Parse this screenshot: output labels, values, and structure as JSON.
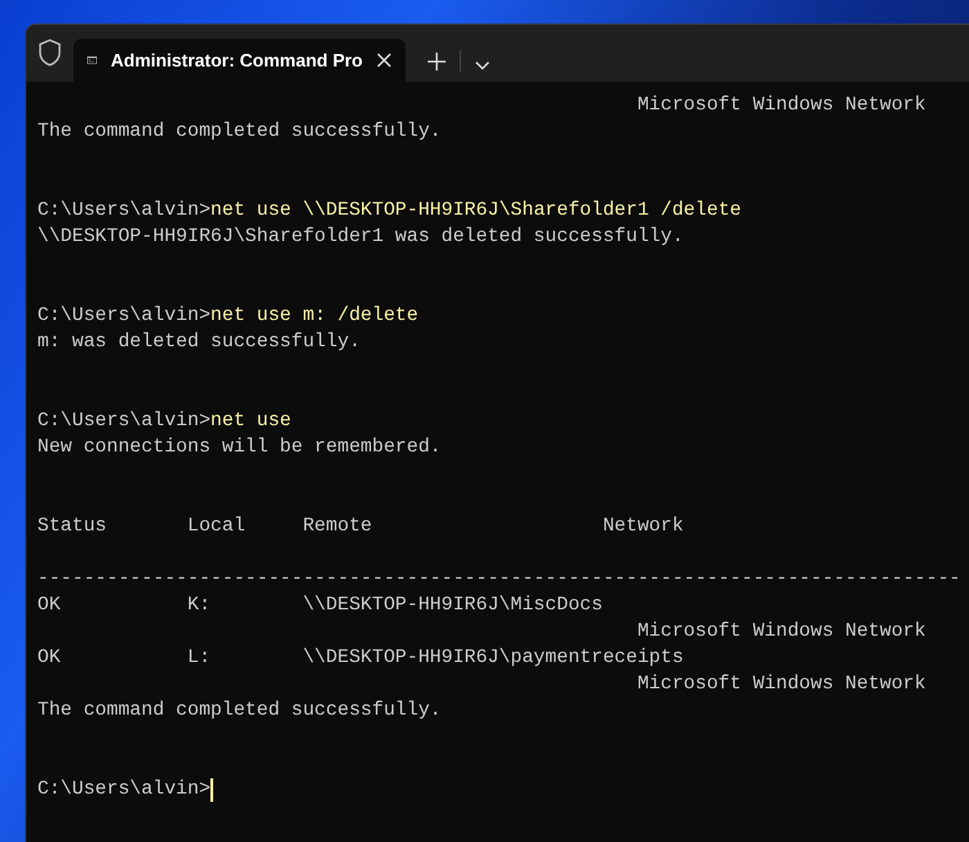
{
  "window": {
    "tab_title": "Administrator: Command Pro"
  },
  "terminal": {
    "lines": [
      {
        "kind": "output",
        "text": "                                                    Microsoft Windows Network"
      },
      {
        "kind": "output",
        "text": "The command completed successfully."
      },
      {
        "kind": "blank"
      },
      {
        "kind": "blank"
      },
      {
        "kind": "command",
        "prompt": "C:\\Users\\alvin>",
        "command": "net use \\\\DESKTOP-HH9IR6J\\Sharefolder1 /delete"
      },
      {
        "kind": "output",
        "text": "\\\\DESKTOP-HH9IR6J\\Sharefolder1 was deleted successfully."
      },
      {
        "kind": "blank"
      },
      {
        "kind": "blank"
      },
      {
        "kind": "command",
        "prompt": "C:\\Users\\alvin>",
        "command": "net use m: /delete"
      },
      {
        "kind": "output",
        "text": "m: was deleted successfully."
      },
      {
        "kind": "blank"
      },
      {
        "kind": "blank"
      },
      {
        "kind": "command",
        "prompt": "C:\\Users\\alvin>",
        "command": "net use"
      },
      {
        "kind": "output",
        "text": "New connections will be remembered."
      },
      {
        "kind": "blank"
      },
      {
        "kind": "blank"
      },
      {
        "kind": "output",
        "text": "Status       Local     Remote                    Network"
      },
      {
        "kind": "blank"
      },
      {
        "kind": "output",
        "text": "--------------------------------------------------------------------------------"
      },
      {
        "kind": "output",
        "text": "OK           K:        \\\\DESKTOP-HH9IR6J\\MiscDocs"
      },
      {
        "kind": "output",
        "text": "                                                    Microsoft Windows Network"
      },
      {
        "kind": "output",
        "text": "OK           L:        \\\\DESKTOP-HH9IR6J\\paymentreceipts"
      },
      {
        "kind": "output",
        "text": "                                                    Microsoft Windows Network"
      },
      {
        "kind": "output",
        "text": "The command completed successfully."
      },
      {
        "kind": "blank"
      },
      {
        "kind": "blank"
      },
      {
        "kind": "command",
        "prompt": "C:\\Users\\alvin>",
        "cursor": true
      }
    ]
  }
}
